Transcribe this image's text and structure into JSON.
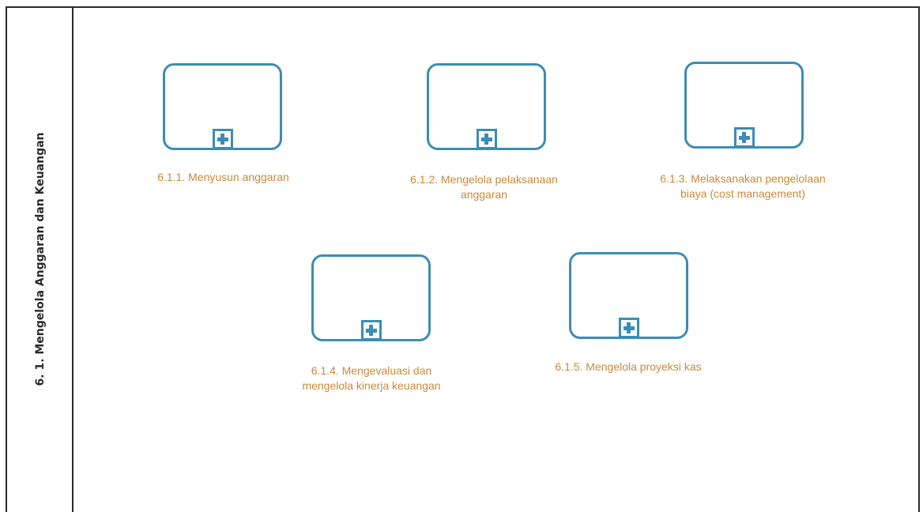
{
  "lane": {
    "title": "6. 1. Mengelola Anggaran dan Keuangan"
  },
  "tasks": [
    {
      "label": "6.1.1. Menyusun anggaran"
    },
    {
      "label": "6.1.2. Mengelola pelaksanaan\nanggaran"
    },
    {
      "label": "6.1.3. Melaksanakan pengelolaan\nbiaya (cost management)"
    },
    {
      "label": "6.1.4. Mengevaluasi dan\nmengelola kinerja keuangan"
    },
    {
      "label": "6.1.5. Mengelola proyeksi kas"
    }
  ],
  "colors": {
    "task_border": "#3b8db6",
    "label_text": "#c98a3a",
    "lane_border": "#2b2b2b"
  },
  "icons": {
    "subprocess_marker": "collapsed-subprocess-plus-icon"
  }
}
